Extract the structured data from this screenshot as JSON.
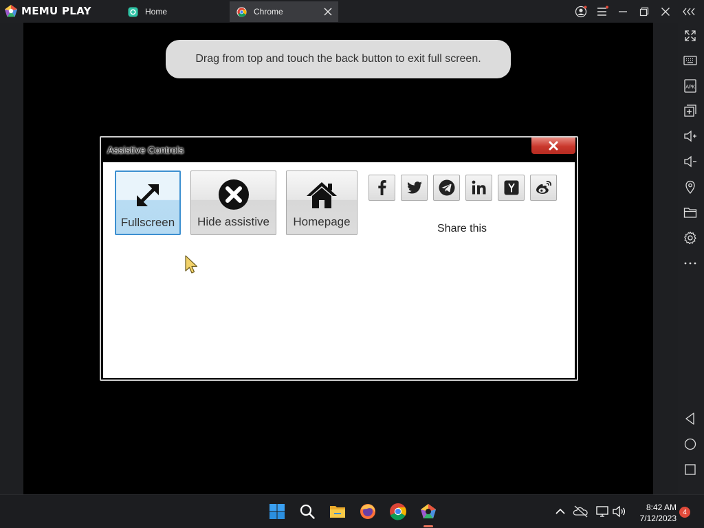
{
  "titlebar": {
    "app_name": "MEMU PLAY",
    "tabs": [
      {
        "label": "Home",
        "icon": "memu-home-icon",
        "active": false
      },
      {
        "label": "Chrome",
        "icon": "chrome-icon",
        "active": true
      }
    ],
    "controls": [
      "account-icon",
      "menu-icon",
      "minimize-icon",
      "restore-icon",
      "close-icon",
      "collapse-sidebar-icon"
    ]
  },
  "screen": {
    "toast": "Drag from top and touch the back button to exit full screen."
  },
  "dialog": {
    "title": "Assistive Controls",
    "buttons": [
      {
        "label": "Fullscreen",
        "icon": "fullscreen-arrows-icon",
        "selected": true
      },
      {
        "label": "Hide assistive",
        "icon": "x-circle-icon",
        "selected": false
      },
      {
        "label": "Homepage",
        "icon": "house-icon",
        "selected": false
      }
    ],
    "share": {
      "label": "Share this",
      "networks": [
        "facebook",
        "twitter",
        "telegram",
        "linkedin",
        "hacker-news",
        "weibo"
      ]
    }
  },
  "sidebar": {
    "items": [
      "fullscreen-icon",
      "keyboard-icon",
      "apk-icon",
      "add-app-icon",
      "volume-up-icon",
      "volume-down-icon",
      "location-icon",
      "folder-icon",
      "settings-icon",
      "more-icon",
      "back-icon",
      "home-icon",
      "recents-icon"
    ]
  },
  "taskbar": {
    "apps": [
      "windows-start-icon",
      "search-icon",
      "file-explorer-icon",
      "firefox-icon",
      "chrome-icon",
      "memu-icon"
    ],
    "tray": [
      "chevron-up-icon",
      "onedrive-icon",
      "network-icon",
      "volume-icon"
    ],
    "time": "8:42 AM",
    "date": "7/12/2023",
    "notifications": "4"
  },
  "colors": {
    "titlebar": "#1f2023",
    "active_tab": "#3a3b3f",
    "dialog_close": "#c9372c",
    "selected_button": "#3c8fd0",
    "notification_badge": "#e04a3a"
  }
}
